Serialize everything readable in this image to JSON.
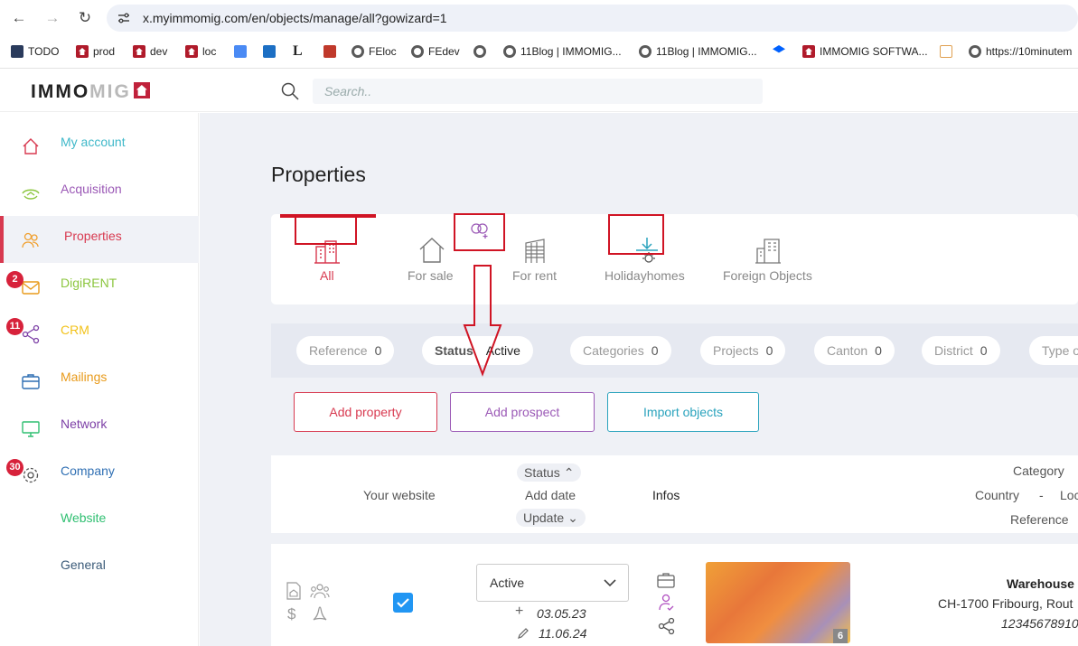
{
  "browser": {
    "url": "x.myimmomig.com/en/objects/manage/all?gowizard=1",
    "bookmarks": [
      "TODO",
      "prod",
      "dev",
      "loc",
      "FEloc",
      "FEdev",
      "11Blog | IMMOMIG...",
      "11Blog | IMMOMIG...",
      "IMMOMIG SOFTWA...",
      "https://10minutem"
    ]
  },
  "header": {
    "logo_a": "IMMO",
    "logo_b": "MIG",
    "search_placeholder": "Search.."
  },
  "sidebar": {
    "items": [
      {
        "label": "My account",
        "color": "#3fb8c9",
        "badge": ""
      },
      {
        "label": "Acquisition",
        "color": "#9b59b6",
        "badge": ""
      },
      {
        "label": "Properties",
        "color": "#d83a50",
        "badge": ""
      },
      {
        "label": "DigiRENT",
        "color": "#8cc63f",
        "badge": "2"
      },
      {
        "label": "CRM",
        "color": "#f2c21a",
        "badge": "11"
      },
      {
        "label": "Mailings",
        "color": "#e89a1a",
        "badge": ""
      },
      {
        "label": "Network",
        "color": "#7c3fa6",
        "badge": ""
      },
      {
        "label": "Company",
        "color": "#2f6fb3",
        "badge": "30"
      },
      {
        "label": "Website",
        "color": "#2fbf71",
        "badge": ""
      },
      {
        "label": "General",
        "color": "#3a5a78",
        "badge": ""
      }
    ]
  },
  "main": {
    "title": "Properties",
    "tabs": [
      "All",
      "For sale",
      "For rent",
      "Holidayhomes",
      "Foreign Objects"
    ],
    "filters": [
      {
        "label": "Reference",
        "value": "0"
      },
      {
        "label": "Status",
        "value": "Active"
      },
      {
        "label": "Categories",
        "value": "0"
      },
      {
        "label": "Projects",
        "value": "0"
      },
      {
        "label": "Canton",
        "value": "0"
      },
      {
        "label": "District",
        "value": "0"
      },
      {
        "label": "Type o",
        "value": ""
      }
    ],
    "buttons": {
      "add_property": "Add property",
      "add_prospect": "Add prospect",
      "import_objects": "Import objects"
    },
    "table_head": {
      "your_website": "Your website",
      "status": "Status",
      "add_date": "Add date",
      "update": "Update",
      "infos": "Infos",
      "category": "Category",
      "country": "Country",
      "dash": "-",
      "loc": "Loc",
      "reference": "Reference"
    },
    "row": {
      "status_value": "Active",
      "add_date": "03.05.23",
      "update_date": "11.06.24",
      "image_count": "6",
      "title": "Warehouse",
      "location": "CH-1700 Fribourg, Rout",
      "reference": "12345678910"
    }
  },
  "colors": {
    "accent": "#d83a50",
    "annotation": "#d01424",
    "prospect": "#9b59b6",
    "import": "#2aa3bd"
  }
}
